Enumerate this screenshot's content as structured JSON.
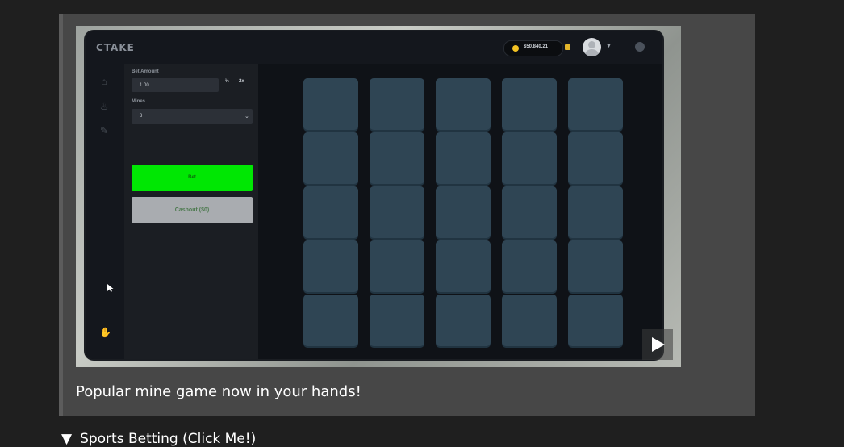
{
  "caption": "Popular mine game now in your hands!",
  "details_summary": {
    "arrow": "▼",
    "label": "Sports Betting (Click Me!)"
  },
  "game": {
    "brand": "CTAKE",
    "balance": "$50,840.21",
    "bet_amount_label": "Bet Amount",
    "bet_amount_value": "1.00",
    "half_label": "½",
    "double_label": "2x",
    "mines_label": "Mines",
    "mines_value": "3",
    "bet_button_label": "Bet",
    "cashout_button_label": "Cashout ($0)",
    "grid_rows": 5,
    "grid_cols": 5
  },
  "colors": {
    "bet_button": "#00e703",
    "tile": "#2f4554",
    "coin": "#f3c223"
  },
  "icons": [
    "home-icon",
    "fire-icon",
    "pencil-icon",
    "hand-icon",
    "play-icon",
    "chevron-down-icon",
    "chat-icon",
    "wallet-icon"
  ]
}
